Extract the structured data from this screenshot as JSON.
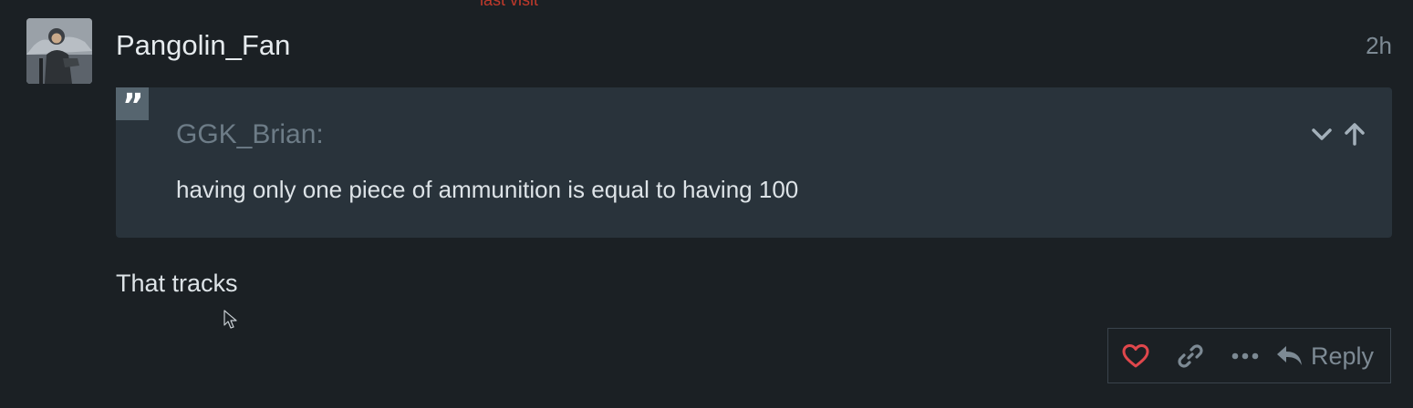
{
  "header_partial": {
    "last_visit_label": "last visit"
  },
  "post": {
    "username": "Pangolin_Fan",
    "date": "2h",
    "avatar_icon": "user-avatar",
    "quote": {
      "author": "GGK_Brian:",
      "text": "having only one piece of ammunition is equal to having 100",
      "icons": [
        "quote-icon",
        "chevron-down-icon",
        "arrow-up-icon"
      ]
    },
    "body": "That tracks",
    "actions": {
      "like_icon": "heart-icon",
      "link_icon": "link-icon",
      "more_icon": "ellipsis-icon",
      "reply_icon": "reply-icon",
      "reply_label": "Reply"
    }
  },
  "colors": {
    "background": "#1b2024",
    "quote_background": "#29333b",
    "like_red": "#e0474c",
    "muted": "#7d8a94"
  }
}
